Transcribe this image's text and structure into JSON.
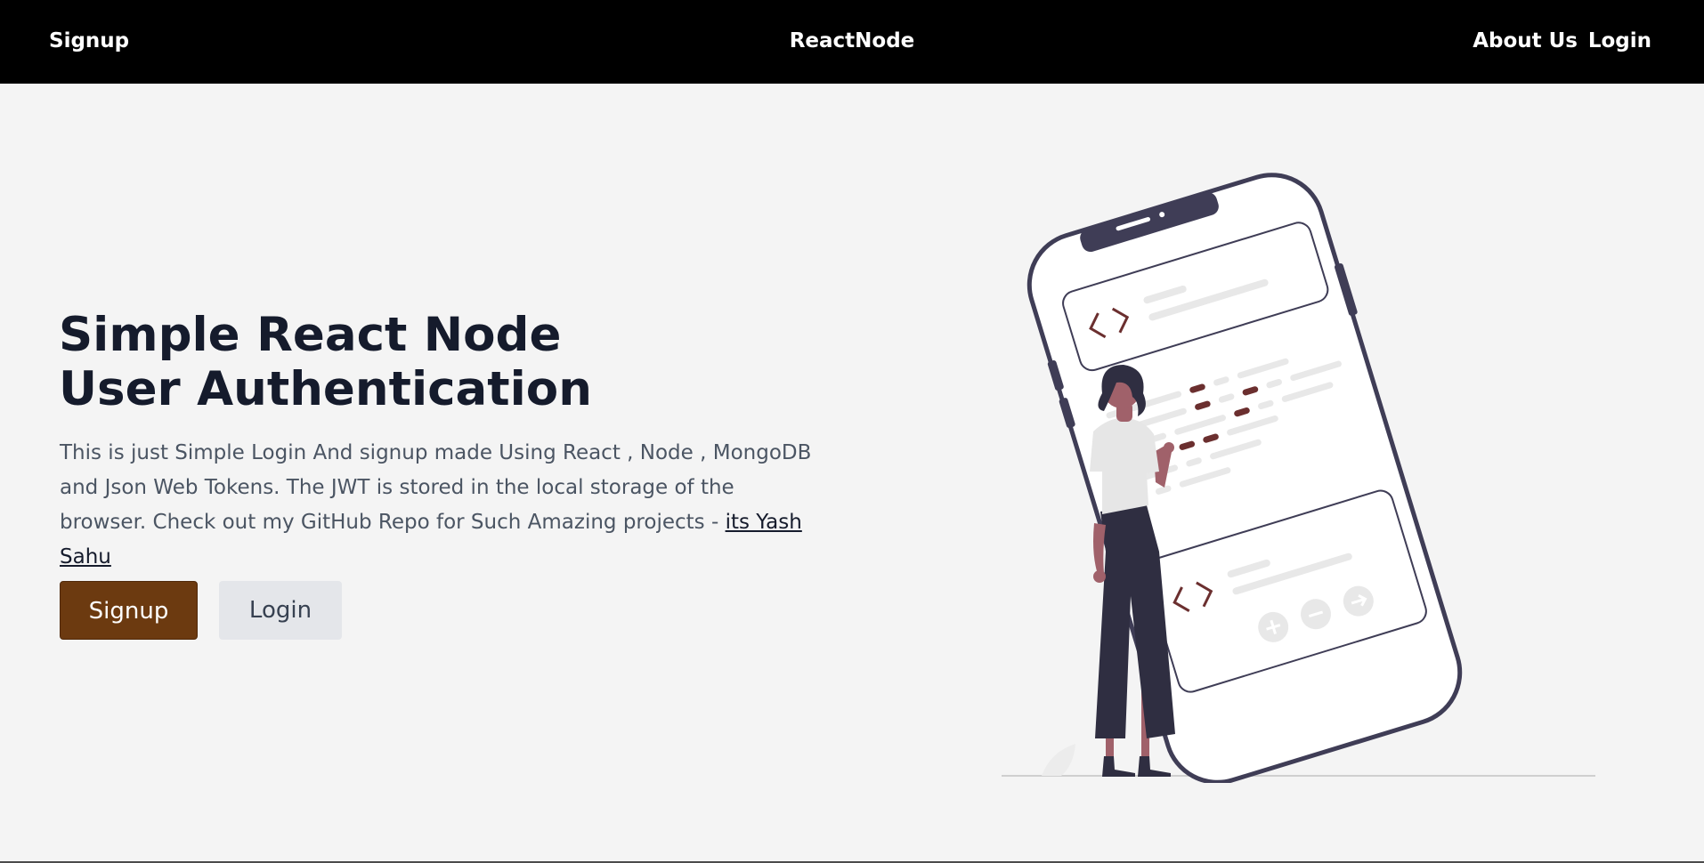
{
  "navbar": {
    "left_link": "Signup",
    "brand": "ReactNode",
    "about": "About Us",
    "login": "Login"
  },
  "hero": {
    "title_line1": "Simple React Node",
    "title_line2": "User Authentication",
    "description": "This is just Simple Login And signup made Using React , Node , MongoDB and Json Web Tokens. The JWT is stored in the local storage of the browser. Check out my GitHub Repo for Such Amazing projects - ",
    "link_text": "its Yash Sahu",
    "signup_button": "Signup",
    "login_button": "Login"
  },
  "colors": {
    "navbar_bg": "#000000",
    "page_bg": "#f4f4f4",
    "primary_button": "#6c3a10",
    "secondary_button": "#e4e6ea",
    "illustration_dark": "#3f3d56",
    "illustration_accent": "#6b2f2f"
  }
}
